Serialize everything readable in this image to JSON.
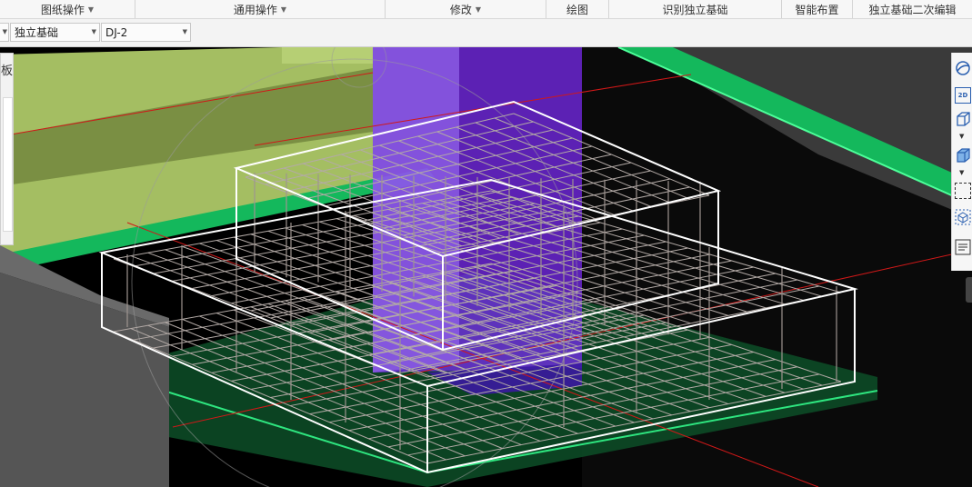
{
  "ribbon": {
    "groups": [
      {
        "label": "图纸操作",
        "has_dropdown": true
      },
      {
        "label": "通用操作",
        "has_dropdown": true
      },
      {
        "label": "修改",
        "has_dropdown": true
      },
      {
        "label": "绘图",
        "has_dropdown": false
      },
      {
        "label": "识别独立基础",
        "has_dropdown": false
      },
      {
        "label": "智能布置",
        "has_dropdown": false
      },
      {
        "label": "独立基础二次编辑",
        "has_dropdown": false
      }
    ]
  },
  "selector": {
    "element_type": "独立基础",
    "element_name": "DJ-2"
  },
  "left_panel": {
    "partial_label": "板"
  },
  "right_toolbar": {
    "items": [
      "orbit-icon",
      "view-2d-icon",
      "box-view-icon",
      "dropdown-arrow-icon",
      "solid-box-icon",
      "dropdown-arrow-icon",
      "dashed-select-icon",
      "cube-select-icon",
      "list-icon"
    ],
    "labels": {
      "view_2d": "2D"
    }
  },
  "colors": {
    "viewport_bg": "#000000",
    "green_slab": "#1ad06a",
    "wall_olive": "#a4be62",
    "column_purple": "#7b2cf0",
    "rebar_white": "#ffffff",
    "rebar_grey": "#b3aaa6",
    "axis_red": "#d01818"
  }
}
